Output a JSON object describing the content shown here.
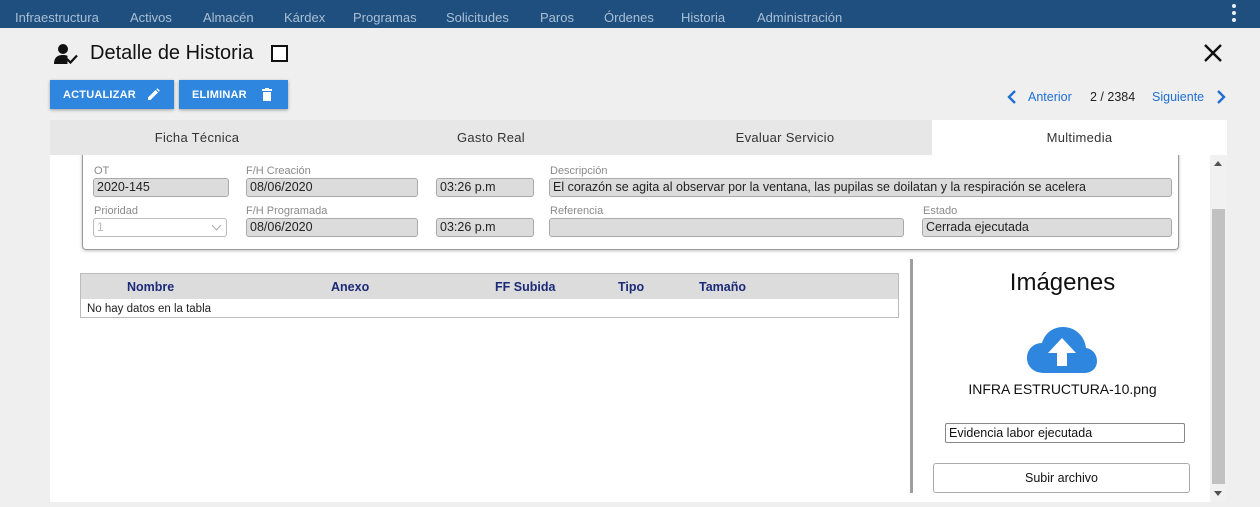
{
  "nav": {
    "items": [
      "Infraestructura",
      "Activos",
      "Almacén",
      "Kárdex",
      "Programas",
      "Solicitudes",
      "Paros",
      "Órdenes",
      "Historia",
      "Administración"
    ]
  },
  "header": {
    "title": "Detalle de Historia"
  },
  "toolbar": {
    "update_label": "ACTUALIZAR",
    "delete_label": "ELIMINAR"
  },
  "pager": {
    "prev_label": "Anterior",
    "position": "2 / 2384",
    "next_label": "Siguiente"
  },
  "tabs": [
    {
      "label": "Ficha Técnica"
    },
    {
      "label": "Gasto Real"
    },
    {
      "label": "Evaluar Servicio"
    },
    {
      "label": "Multimedia"
    }
  ],
  "form": {
    "ot": {
      "label": "OT",
      "value": "2020-145"
    },
    "creacion": {
      "label": "F/H Creación",
      "date": "08/06/2020",
      "time": "03:26  p.m"
    },
    "descripcion": {
      "label": "Descripción",
      "value": "El corazón se agita al observar por la ventana, las pupilas se doilatan y la respiración se acelera"
    },
    "prioridad": {
      "label": "Prioridad",
      "value": "1"
    },
    "programada": {
      "label": "F/H Programada",
      "date": "08/06/2020",
      "time": "03:26  p.m"
    },
    "referencia": {
      "label": "Referencia",
      "value": ""
    },
    "estado": {
      "label": "Estado",
      "value": "Cerrada ejecutada"
    }
  },
  "table": {
    "columns": [
      "Nombre",
      "Anexo",
      "FF Subida",
      "Tipo",
      "Tamaño"
    ],
    "empty_text": "No hay datos en la tabla"
  },
  "images": {
    "title": "Imágenes",
    "file_name": "INFRA ESTRUCTURA-10.png",
    "description_value": "Evidencia labor ejecutada",
    "upload_label": "Subir archivo"
  },
  "colors": {
    "nav_bg": "#1f4f7e",
    "accent": "#2e86de",
    "link": "#1f6fd1",
    "upload_icon": "#2e86de"
  }
}
